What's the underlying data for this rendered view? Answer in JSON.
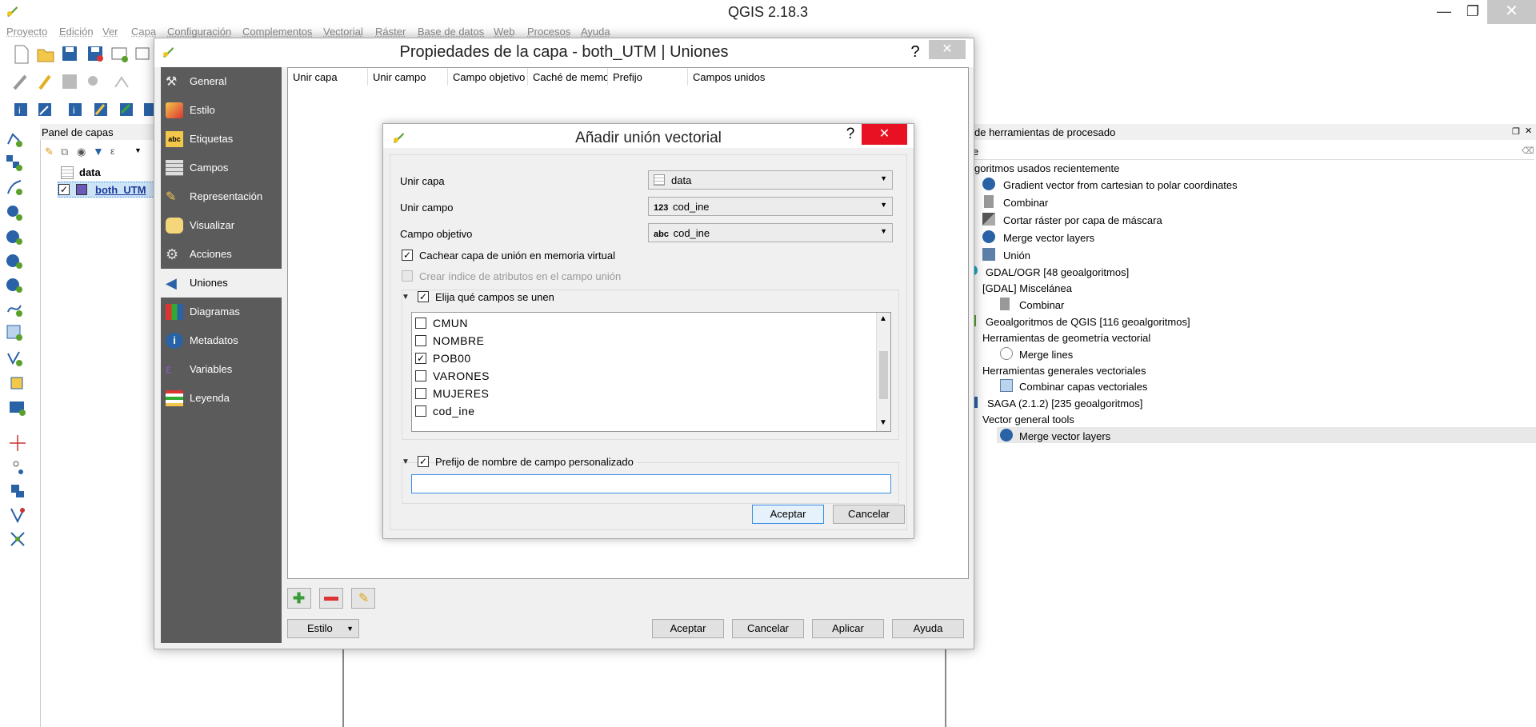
{
  "app": {
    "title": "QGIS 2.18.3"
  },
  "menu": [
    "Proyecto",
    "Edición",
    "Ver",
    "Capa",
    "Configuración",
    "Complementos",
    "Vectorial",
    "Ráster",
    "Base de datos",
    "Web",
    "Procesos",
    "Ayuda"
  ],
  "layers_panel": {
    "title": "Panel de capas",
    "layers": [
      {
        "name": "data",
        "checked": false
      },
      {
        "name": "both_UTM",
        "checked": true
      }
    ]
  },
  "processing_panel": {
    "title": "de herramientas de procesado",
    "search_value": "e",
    "items": [
      "goritmos usados recientemente",
      "Gradient vector from cartesian to polar coordinates",
      "Combinar",
      "Cortar ráster por capa de máscara",
      "Merge vector layers",
      "Unión",
      "GDAL/OGR [48 geoalgoritmos]",
      "[GDAL] Miscelánea",
      "Combinar",
      "Geoalgoritmos de QGIS [116 geoalgoritmos]",
      "Herramientas de geometría vectorial",
      "Merge lines",
      "Herramientas generales vectoriales",
      "Combinar capas vectoriales",
      "SAGA (2.1.2) [235 geoalgoritmos]",
      "Vector general tools",
      "Merge vector layers"
    ]
  },
  "props_dialog": {
    "title": "Propiedades de la capa - both_UTM | Uniones",
    "help": "?",
    "close": "✕",
    "nav": [
      "General",
      "Estilo",
      "Etiquetas",
      "Campos",
      "Representación",
      "Visualizar",
      "Acciones",
      "Uniones",
      "Diagramas",
      "Metadatos",
      "Variables",
      "Leyenda"
    ],
    "active_nav": "Uniones",
    "columns": [
      "Unir capa",
      "Unir campo",
      "Campo objetivo",
      "Caché de memo",
      "Prefijo",
      "Campos unidos"
    ],
    "style_button": "Estilo",
    "buttons": {
      "accept": "Aceptar",
      "cancel": "Cancelar",
      "apply": "Aplicar",
      "help": "Ayuda"
    }
  },
  "add_join_dialog": {
    "title": "Añadir unión vectorial",
    "help": "?",
    "close": "✕",
    "join_layer_label": "Unir capa",
    "join_layer_value": "data",
    "join_field_label": "Unir campo",
    "join_field_type": "123",
    "join_field_value": "cod_ine",
    "target_field_label": "Campo objetivo",
    "target_field_type": "abc",
    "target_field_value": "cod_ine",
    "cache_label": "Cachear capa de unión en memoria virtual",
    "cache_checked": true,
    "index_label": "Crear índice de atributos en el campo unión",
    "index_checked": false,
    "choose_fields_label": "Elija qué campos se unen",
    "choose_fields_checked": true,
    "fields": [
      {
        "name": "CMUN",
        "checked": false
      },
      {
        "name": "NOMBRE",
        "checked": false
      },
      {
        "name": "POB00",
        "checked": true
      },
      {
        "name": "VARONES",
        "checked": false
      },
      {
        "name": "MUJERES",
        "checked": false
      },
      {
        "name": "cod_ine",
        "checked": false
      }
    ],
    "prefix_label": "Prefijo de nombre de campo personalizado",
    "prefix_checked": true,
    "prefix_value": "",
    "accept": "Aceptar",
    "cancel": "Cancelar"
  },
  "colors": {
    "accent": "#1e63b5",
    "nav_bg": "#5b5b5b",
    "close_red": "#e81123"
  }
}
